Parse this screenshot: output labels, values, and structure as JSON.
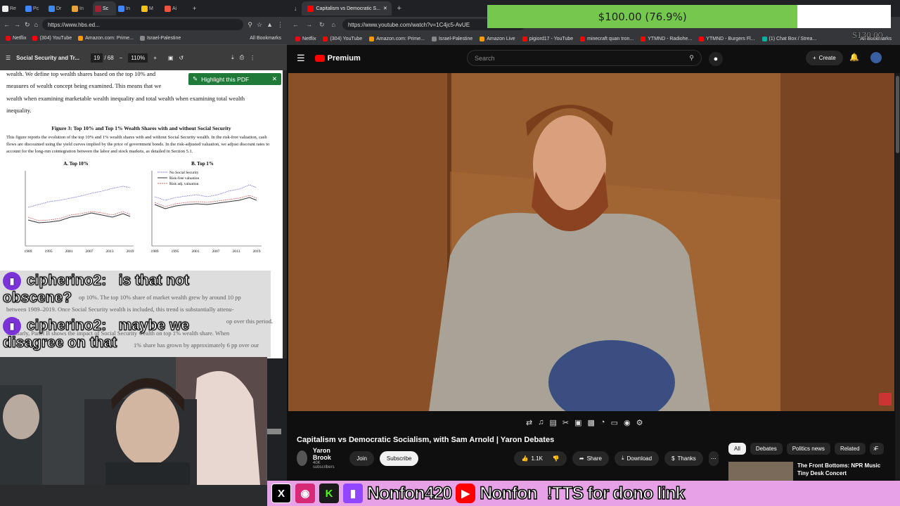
{
  "left_browser": {
    "tabs": [
      {
        "label": "Re",
        "color": "#eeeeee",
        "active": false
      },
      {
        "label": "Pc",
        "color": "#4285f4",
        "active": false
      },
      {
        "label": "Dr",
        "color": "#4285f4",
        "active": false
      },
      {
        "label": "In",
        "color": "#e8a33a",
        "active": false
      },
      {
        "label": "Sc",
        "color": "#a31f34",
        "active": true
      },
      {
        "label": "In",
        "color": "#4285f4",
        "active": false
      },
      {
        "label": "M",
        "color": "#f2c21b",
        "active": false
      },
      {
        "label": "Ai",
        "color": "#e8573a",
        "active": false
      }
    ],
    "url": "https://www.hbs.ed...",
    "bookmarks": [
      {
        "label": "Netflix",
        "color": "#e50914"
      },
      {
        "label": "(304) YouTube",
        "color": "#ff0000"
      },
      {
        "label": "Amazon.com: Prime...",
        "color": "#ff9900"
      },
      {
        "label": "Israel-Palestine",
        "color": "#888888"
      }
    ],
    "all_bookmarks": "All Bookmarks",
    "pdf": {
      "title": "Social Security and Tr...",
      "page": "19",
      "page_total": "/ 68",
      "zoom": "110%",
      "highlight_button": "Highlight this PDF",
      "para1": "wealth.  We define top wealth shares based on the top 10% and",
      "para2": "measures of wealth concept being examined.  This means that we",
      "para3": "wealth when examining marketable wealth inequality and total wealth when examining total wealth",
      "para4": "inequality.",
      "fig_title": "Figure 3: Top 10% and Top 1% Wealth Shares with and without Social Security",
      "caption": "This figure reports the evolution of the top 10% and 1% wealth shares with and without Social Security wealth. In the risk-free valuation, cash flows are discounted using the yield curves implied by the price of government bonds. In the risk-adjusted valuation, we adjust discount rates to account for the long-run cointegration between the labor and stock markets, as detailed in Section 5.1.",
      "panel_a": "A. Top 10%",
      "panel_b": "B. Top 1%",
      "legend": [
        "No Social Security",
        "Risk-free valuation",
        "Risk adj. valuation"
      ],
      "x_ticks": [
        "1989",
        "1995",
        "2001",
        "2007",
        "2013",
        "2019"
      ],
      "body1": "op 10%. The top 10% share of market wealth grew by around 10 pp",
      "body2": "between 1989–2019.  Once Social Security wealth is included, this trend is substantially attenu-",
      "body3": "Panel",
      "body4": "op over this period.",
      "body5": "Similarly, Panel B shows the impact of Social Security wealth on top 1% wealth share.  When",
      "body6": "1% share has grown by approximately 6 pp over our"
    }
  },
  "chat": [
    {
      "user": "cipherino2:",
      "message_line1": "is that not",
      "message_line2": "obscene?"
    },
    {
      "user": "cipherino2:",
      "message_line1": "maybe we",
      "message_line2": "disagree on that"
    }
  ],
  "right_browser": {
    "tab_title": "Capitalism vs Democratic S...",
    "url": "https://www.youtube.com/watch?v=1C4jc5-AvUE",
    "bookmarks": [
      {
        "label": "Netflix",
        "color": "#e50914"
      },
      {
        "label": "(304) YouTube",
        "color": "#ff0000"
      },
      {
        "label": "Amazon.com: Prime...",
        "color": "#ff9900"
      },
      {
        "label": "Israel-Palestine",
        "color": "#888888"
      },
      {
        "label": "Amazon Live",
        "color": "#ff9900"
      },
      {
        "label": "pigiord17 - YouTube",
        "color": "#ff0000"
      },
      {
        "label": "minecraft quan tron...",
        "color": "#ff0000"
      },
      {
        "label": "YTMND - Radiohe...",
        "color": "#ff0000"
      },
      {
        "label": "YTMND - Burgers Fl...",
        "color": "#ff0000"
      },
      {
        "label": "(1) Chat Box / Strea...",
        "color": "#00b3a1"
      }
    ],
    "all_bookmarks": "All Bookmarks",
    "youtube": {
      "logo": "Premium",
      "search_placeholder": "Search",
      "create": "Create",
      "video_title": "Capitalism vs Democratic Socialism, with Sam Arnold | Yaron Debates",
      "channel": "Yaron Brook",
      "subscribers": "40K subscribers",
      "join": "Join",
      "subscribe": "Subscribe",
      "likes": "1.1K",
      "share": "Share",
      "download": "Download",
      "thanks": "Thanks",
      "chips": [
        "All",
        "Debates",
        "Politics news",
        "Related",
        "F"
      ],
      "rec_title1": "The Front Bottoms: NPR Music",
      "rec_title2": "Tiny Desk Concert"
    }
  },
  "donation": {
    "amount": "$100.00 (76.9%)",
    "progress": 0.769,
    "goal": "$130.00"
  },
  "banner": {
    "handle1": "Nonfon420",
    "handle2": "Nonfon",
    "tts": "!TTS for dono link"
  }
}
